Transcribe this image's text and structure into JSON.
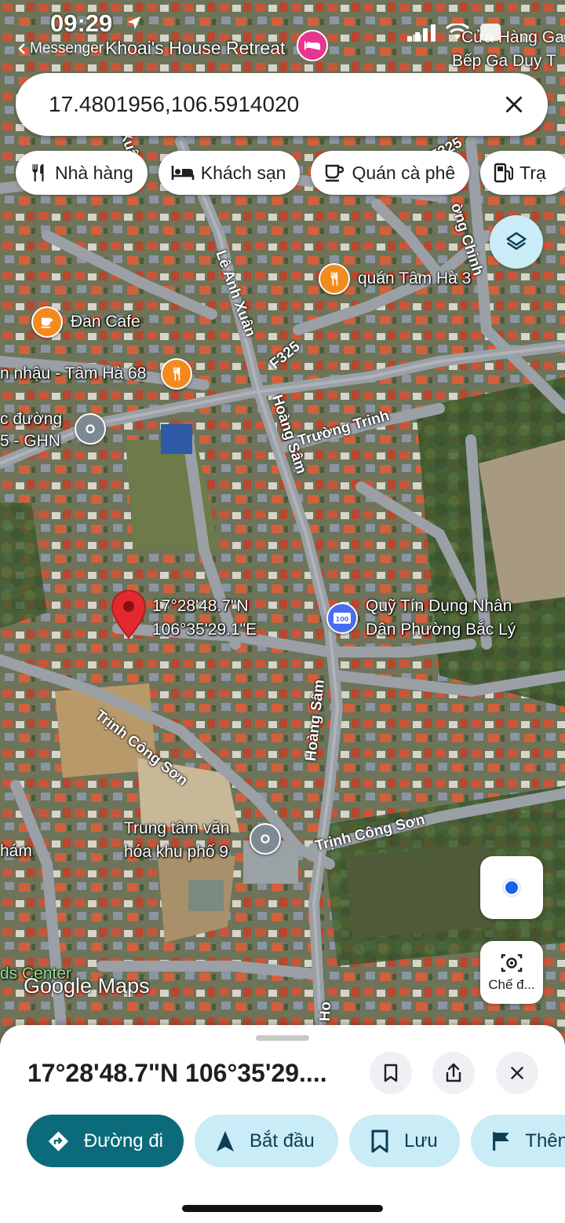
{
  "status_bar": {
    "time": "09:29",
    "back_label": "Messenger",
    "top_place_label": "Khoai's House Retreat",
    "top_right_label_1": "Cửa Hàng Ga",
    "top_right_label_2": "Bếp Ga Duy T"
  },
  "search": {
    "query": "17.4801956,106.5914020"
  },
  "chips": [
    {
      "label": "Nhà hàng",
      "icon": "restaurant-icon"
    },
    {
      "label": "Khách sạn",
      "icon": "hotel-icon"
    },
    {
      "label": "Quán cà phê",
      "icon": "coffee-icon"
    },
    {
      "label": "Trạ",
      "icon": "gas-station-icon"
    }
  ],
  "map": {
    "roads": {
      "le_anh_xuan": "Lê Anh Xuân",
      "f325": "F325",
      "f325_top": "F325",
      "hoang_sam_1": "Hoàng Sâm",
      "hoang_sam_2": "Hoàng Sâm",
      "hoang_sam_3": "Ho",
      "truong_trinh": "Trường Trinh",
      "trinh_cong_son_1": "Trịnh Công Sơn",
      "trinh_cong_son_2": "Trịnh Công Sơn",
      "xuan_top": "Xuân",
      "top_right_road": "ờng Chinh"
    },
    "places": {
      "quan_tam_ha_3": "quán Tâm Hà 3",
      "dan_cafe": "Đan Cafe",
      "nhau_tam_ha_68": "n nhậu - Tâm Hà 68",
      "ghn_line1": "c đường",
      "ghn_line2": "5 - GHN",
      "quy_tin_dung_line1": "Quỹ Tín Dụng Nhân",
      "quy_tin_dung_line2": "Dân Phường Bắc Lý",
      "trung_tam_line1": "Trung tâm văn",
      "trung_tam_line2": "hóa khu phố 9",
      "left_edge_label": "hám",
      "bottom_left_label": "ds Center"
    },
    "pin": {
      "lat_label": "17°28'48.7\"N",
      "lng_label": "106°35'29.1\"E"
    },
    "atm_badge": "100",
    "brand": "Google Maps",
    "capture_button_label": "Chế đ..."
  },
  "sheet": {
    "title": "17°28'48.7\"N 106°35'29....",
    "actions": [
      {
        "label": "Đường đi",
        "icon": "directions-icon"
      },
      {
        "label": "Bắt đầu",
        "icon": "navigation-arrow-icon"
      },
      {
        "label": "Lưu",
        "icon": "bookmark-icon"
      },
      {
        "label": "Thên",
        "icon": "flag-icon"
      }
    ]
  },
  "colors": {
    "accent_teal": "#0b6b7a",
    "secondary_chip": "#c9ecf6",
    "poi_orange": "#f28b1f",
    "pin_red": "#e3292f",
    "hotel_pink": "#e8368f",
    "poi_blue": "#4a6df0"
  }
}
